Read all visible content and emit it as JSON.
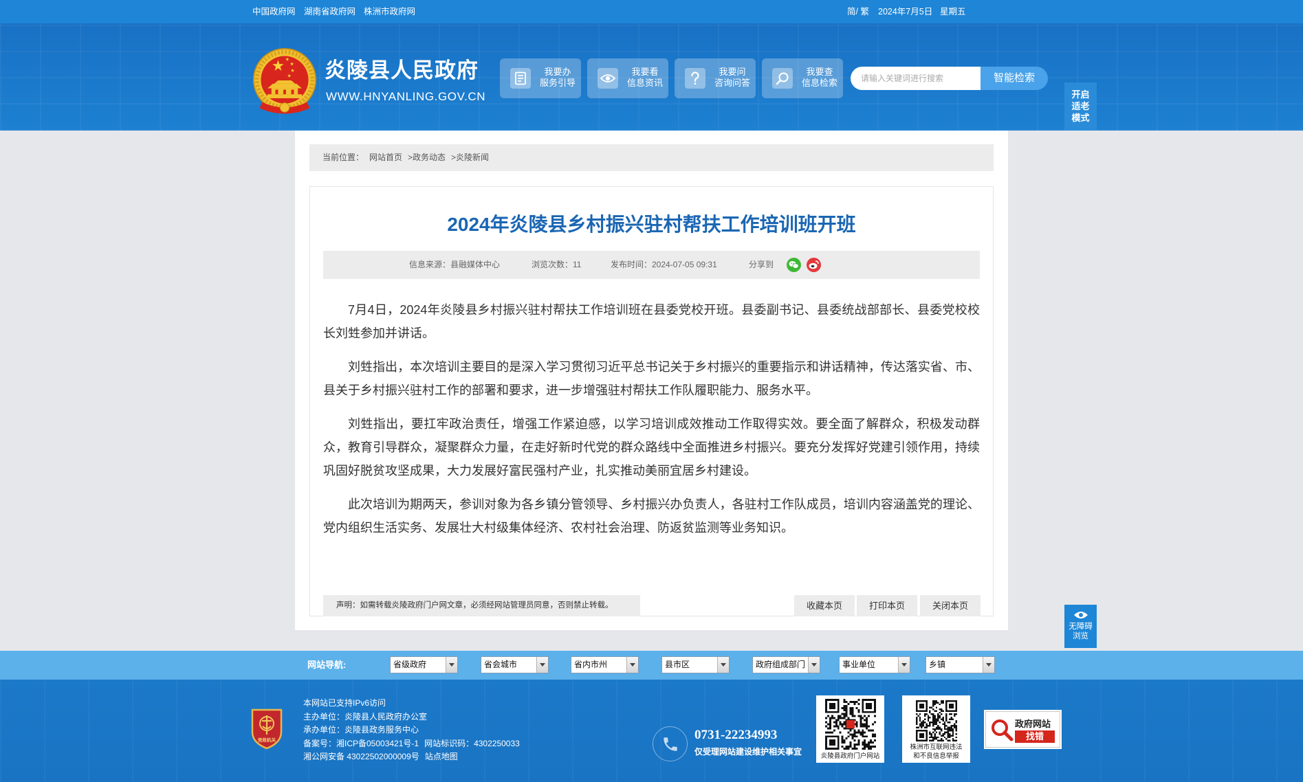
{
  "top_bar": {
    "links": [
      "中国政府网",
      "湖南省政府网",
      "株洲市政府网"
    ],
    "lang_toggle": "简/ 繁",
    "date": "2024年7月5日",
    "weekday": "星期五"
  },
  "header": {
    "emblem_icon": "national-emblem-icon",
    "site_name": "炎陵县人民政府",
    "site_url": "WWW.HNYANLING.GOV.CN",
    "quick_links": [
      {
        "icon": "document-icon",
        "title": "我要办",
        "subtitle": "服务引导"
      },
      {
        "icon": "eye-icon",
        "title": "我要看",
        "subtitle": "信息资讯"
      },
      {
        "icon": "question-icon",
        "title": "我要问",
        "subtitle": "咨询问答"
      },
      {
        "icon": "search-icon",
        "title": "我要查",
        "subtitle": "信息检索"
      }
    ],
    "search": {
      "placeholder": "请输入关键词进行搜索",
      "value": "",
      "button": "智能检索"
    }
  },
  "elder_mode": {
    "lines": [
      "开启",
      "适老",
      "模式"
    ]
  },
  "breadcrumb": {
    "label": "当前位置：",
    "items": [
      "网站首页",
      ">政务动态",
      ">炎陵新闻"
    ]
  },
  "article": {
    "title": "2024年炎陵县乡村振兴驻村帮扶工作培训班开班",
    "meta": {
      "source": "信息来源：县融媒体中心",
      "views": "浏览次数：11",
      "published": "发布时间：2024-07-05 09:31",
      "share_label": "分享到",
      "share_icons": [
        "wechat-icon",
        "weibo-icon"
      ]
    },
    "paragraphs": [
      "7月4日，2024年炎陵县乡村振兴驻村帮扶工作培训班在县委党校开班。县委副书记、县委统战部部长、县委党校校长刘甡参加并讲话。",
      "刘甡指出，本次培训主要目的是深入学习贯彻习近平总书记关于乡村振兴的重要指示和讲话精神，传达落实省、市、县关于乡村振兴驻村工作的部署和要求，进一步增强驻村帮扶工作队履职能力、服务水平。",
      "刘甡指出，要扛牢政治责任，增强工作紧迫感，以学习培训成效推动工作取得实效。要全面了解群众，积极发动群众，教育引导群众，凝聚群众力量，在走好新时代党的群众路线中全面推进乡村振兴。要充分发挥好党建引领作用，持续巩固好脱贫攻坚成果，大力发展好富民强村产业，扎实推动美丽宜居乡村建设。",
      "此次培训为期两天，参训对象为各乡镇分管领导、乡村振兴办负责人，各驻村工作队成员，培训内容涵盖党的理论、党内组织生活实务、发展壮大村级集体经济、农村社会治理、防返贫监测等业务知识。"
    ],
    "declaration": "声明：如需转载炎陵政府门户网文章，必须经网站管理员同意，否则禁止转载。",
    "actions": [
      "收藏本页",
      "打印本页",
      "关闭本页"
    ]
  },
  "accessibility": {
    "icon": "eye-icon",
    "lines": [
      "无障碍",
      "浏览"
    ]
  },
  "site_nav": {
    "label": "网站导航:",
    "selects": [
      "省级政府",
      "省会城市",
      "省内市州",
      "县市区",
      "政府组成部门",
      "事业单位",
      "乡镇"
    ]
  },
  "footer": {
    "logo_text": "党政机关",
    "info": {
      "ipv6": "本网站已支持IPv6访问",
      "sponsor": "主办单位：炎陵县人民政府办公室",
      "organizer": "承办单位：炎陵县政务服务中心",
      "icp": "备案号：湘ICP备05003421号-1",
      "site_code": "网站标识码：4302250033",
      "police": "湘公网安备 43022502000009号",
      "sitemap": "站点地图"
    },
    "phone": "0731-22234993",
    "phone_note": "仅受理网站建设维护相关事宜",
    "qr_codes": [
      {
        "caption": [
          "炎陵县政府门户网站"
        ]
      },
      {
        "caption": [
          "株洲市互联网违法",
          "和不良信息举报"
        ]
      }
    ],
    "error_report": {
      "title": "政府网站",
      "action": "找错"
    }
  },
  "colors": {
    "header_blue": "#1b78c9",
    "title_blue": "#1a66b3",
    "nav_blue": "#5cb1ea",
    "page_bg": "#e6e7eb",
    "accent_red": "#d5261c"
  }
}
